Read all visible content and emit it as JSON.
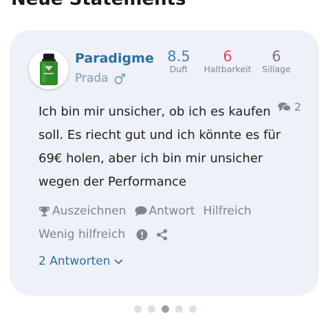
{
  "section": {
    "title": "Neue Statements"
  },
  "perfume": {
    "name": "Paradigme",
    "brand": "Prada",
    "gender_icon": "male-icon"
  },
  "ratings": [
    {
      "value": "8.5",
      "label": "Duft",
      "color": "#4a7fb0"
    },
    {
      "value": "6",
      "label": "Haltbarkeit",
      "color": "#d84a6a"
    },
    {
      "value": "6",
      "label": "Sillage",
      "color": "#7b6f9e"
    }
  ],
  "comments": {
    "count": "2",
    "icon": "comments-icon"
  },
  "statement": {
    "text": "Ich bin mir unsicher, ob ich es kaufen soll. Es riecht gut und ich könnte es für 69€ holen, aber ich bin mir unsicher wegen der Performance"
  },
  "actions": {
    "award": "Auszeichnen",
    "reply": "Antwort",
    "helpful": "Hilfreich",
    "not_helpful": "Wenig hilfreich"
  },
  "replies": {
    "label": "2 Antworten"
  },
  "pagination": {
    "total": 5,
    "active": 3
  },
  "colors": {
    "card": "#eef1f7",
    "link": "#2e6e9e",
    "muted": "#7a8590"
  }
}
